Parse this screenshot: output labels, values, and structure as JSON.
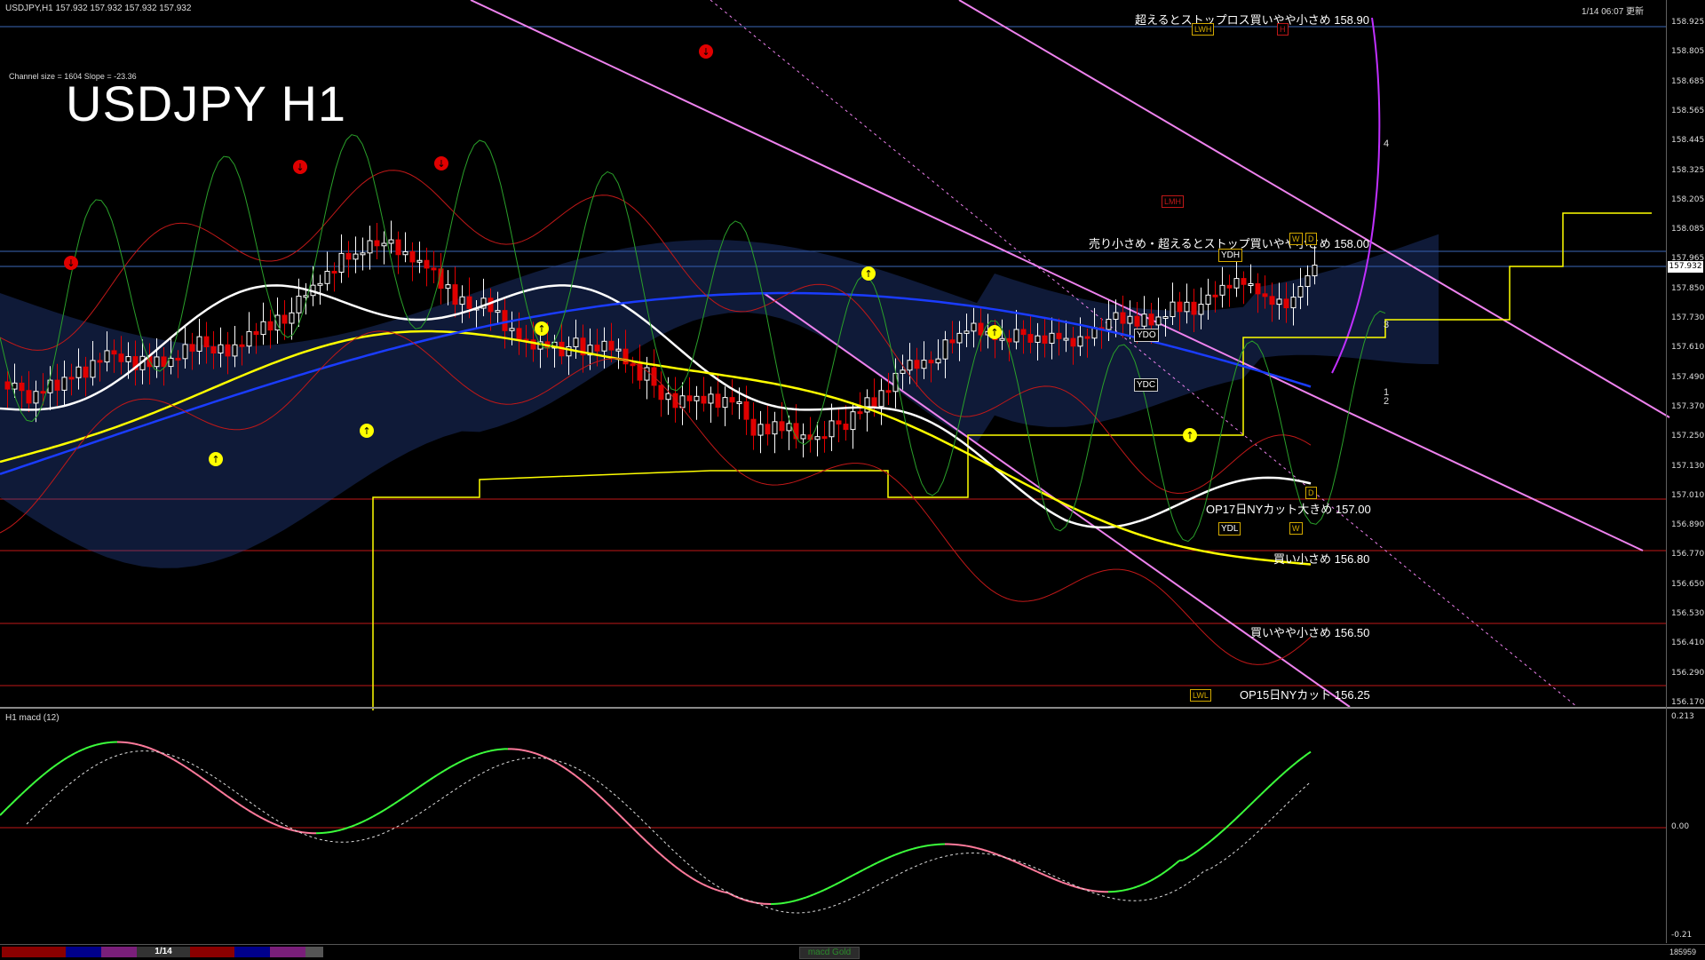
{
  "header": {
    "symbol_info": "USDJPY,H1  157.932 157.932 157.932 157.932",
    "datetime": "1/14 06:07 更新",
    "channel_info": "Channel size = 1604 Slope = -23.36",
    "title": "USDJPY H1"
  },
  "price_axis": {
    "ticks": [
      "158.925",
      "158.805",
      "158.685",
      "158.565",
      "158.445",
      "158.325",
      "158.205",
      "158.085",
      "157.965",
      "157.850",
      "157.730",
      "157.610",
      "157.490",
      "157.370",
      "157.250",
      "157.130",
      "157.010",
      "156.890",
      "156.770",
      "156.650",
      "156.530",
      "156.410",
      "156.290",
      "156.170"
    ],
    "current_price": "157.932",
    "current_price_color": "#ffffff"
  },
  "levels": [
    {
      "label": "超えるとストップロス買いやや小さめ 158.90",
      "color": "#3d67b8"
    },
    {
      "label": "売り小さめ・超えるとストップ買いやや小さめ 158.00",
      "color": "#3d67b8"
    },
    {
      "label": "OP17日NYカット大きめ 157.00",
      "color": "#c01818"
    },
    {
      "label": "買い小さめ 156.80",
      "color": "#c01818"
    },
    {
      "label": "買いやや小さめ 156.50",
      "color": "#c01818"
    },
    {
      "label": "OP15日NYカット 156.25",
      "color": "#c01818"
    }
  ],
  "tags": {
    "ydo": "YDO",
    "ydc": "YDC",
    "ydh": "YDH",
    "ydl": "YDL",
    "lwh": "LWH",
    "lwl": "LWL",
    "lmh": "LMH",
    "w": "W",
    "d": "D",
    "h": "H"
  },
  "channel_markers": [
    "4",
    "3",
    "1",
    "2"
  ],
  "macd": {
    "label": "H1  macd (12)",
    "ticks": [
      "0.213",
      "0.00",
      "-0.21"
    ]
  },
  "bottom": {
    "date_tab": "1/14",
    "indicator_tab": "macd Gold",
    "right_number": "185959",
    "segment_colors": [
      "#8b0000",
      "#00008b",
      "#7a1f7a",
      "#8b0000",
      "#00008b",
      "#7a1f7a"
    ]
  },
  "colors": {
    "bull": "#ffffff",
    "bear": "#e00000",
    "ma_white": "#ffffff",
    "ma_yellow": "#ffff00",
    "ma_blue": "#1a3cff",
    "cloud": "#2a4aa0",
    "channel": "#ee82ee",
    "macd_up": "#3cff3c",
    "macd_down": "#ff7b9c"
  }
}
